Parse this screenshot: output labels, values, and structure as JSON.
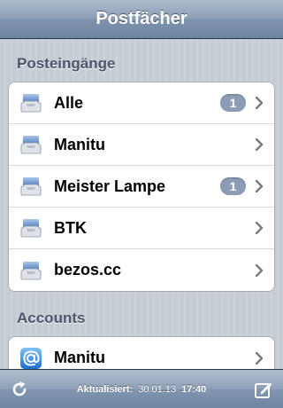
{
  "navbar": {
    "title": "Postfächer"
  },
  "sections": {
    "inboxes": {
      "header": "Posteingänge",
      "items": [
        {
          "label": "Alle",
          "badge": "1",
          "icon": "inbox-tray-icon"
        },
        {
          "label": "Manitu",
          "badge": null,
          "icon": "inbox-tray-icon"
        },
        {
          "label": "Meister Lampe",
          "badge": "1",
          "icon": "inbox-tray-icon"
        },
        {
          "label": "BTK",
          "badge": null,
          "icon": "inbox-tray-icon"
        },
        {
          "label": "bezos.cc",
          "badge": null,
          "icon": "inbox-tray-icon"
        }
      ]
    },
    "accounts": {
      "header": "Accounts",
      "items": [
        {
          "label": "Manitu",
          "icon": "at-sign-icon"
        }
      ]
    }
  },
  "toolbar": {
    "updated_label": "Aktualisiert:",
    "updated_date": "30.01.13",
    "updated_time": "17:40",
    "refresh_icon": "refresh-icon",
    "compose_icon": "compose-icon"
  },
  "colors": {
    "nav_blue": "#6d84a2",
    "badge": "#8d9cb5",
    "section_text": "#4c566c"
  }
}
